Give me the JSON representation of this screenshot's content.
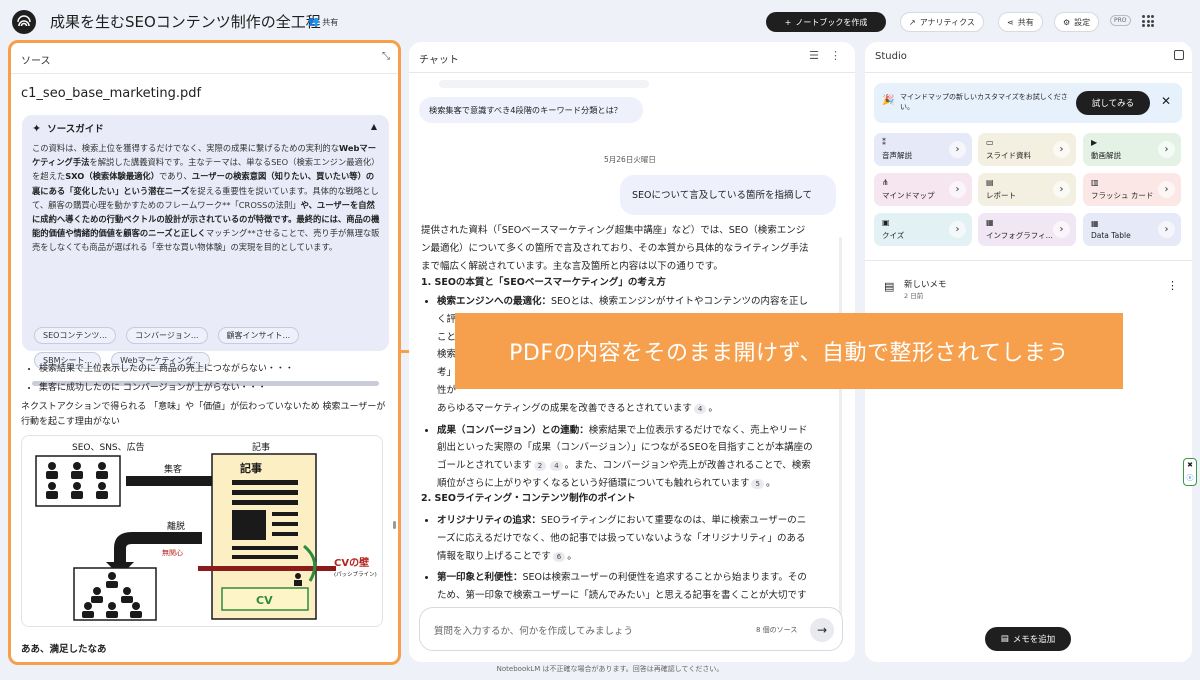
{
  "header": {
    "title": "成果を生むSEOコンテンツ制作の全工程",
    "share_chip": "共有",
    "new_notebook": "ノートブックを作成",
    "analytics": "アナリティクス",
    "share": "共有",
    "settings": "設定",
    "pro": "PRO"
  },
  "source_panel": {
    "heading": "ソース",
    "file_name": "c1_seo_base_marketing.pdf",
    "guide": {
      "title": "ソースガイド",
      "paragraph": [
        {
          "t": "この資料は、検索上位を獲得するだけでなく、実際の成果に繋げるための実利的な",
          "b": false
        },
        {
          "t": "Webマーケティング手法",
          "b": true
        },
        {
          "t": "を解説した講義資料です。主なテーマは、単なるSEO（検索エンジン最適化）を超えた",
          "b": false
        },
        {
          "t": "SXO（検索体験最適化）",
          "b": true
        },
        {
          "t": "であり、",
          "b": false
        },
        {
          "t": "ユーザーの検索意図（知りたい、買いたい等）の裏にある「変化したい」という潜在ニーズ",
          "b": true
        },
        {
          "t": "を捉える重要性を説いています。具体的な戦略として、顧客の購買心理を動かすためのフレームワーク**「CROSSの法則」",
          "b": false
        },
        {
          "t": "や、ユーザーを自然に成約へ導くための行動ベクトルの設計が示されているのが特徴です。最終的には、商品の機能的価値や情緒的価値を顧客のニーズと正しく",
          "b": true
        },
        {
          "t": "マッチング**させることで、売り手が無理な販売をしなくても商品が選ばれる「幸せな買い物体験」の実現を目的としています。",
          "b": false
        }
      ],
      "chips_row1": [
        "SEOコンテンツ...",
        "コンバージョン...",
        "顧客インサイト..."
      ],
      "chips_row2": [
        "SBMシート...",
        "Webマーケティング..."
      ]
    },
    "bullets": [
      "検索結果で上位表示したのに 商品の売上につながらない・・・",
      "集客に成功したのに コンバージョンが上がらない・・・"
    ],
    "question": "ネクストアクションで得られる 「意味」や「価値」が伝わっていないため 検索ユーザーが行動を起こす理由がない",
    "diagram": {
      "label_left": "SEO、SNS、広告",
      "label_right": "記事",
      "arrow_top": "集客",
      "arrow_bottom": "離脱",
      "sub_bottom": "無関心",
      "wall": "CVの壁",
      "wall_sub": "(パッシブライン)",
      "cv": "CV"
    },
    "closing": "ああ、満足したなあ"
  },
  "chat_panel": {
    "heading": "チャット",
    "prev_question": "検索集客で意識すべき4段階のキーワード分類とは？",
    "date": "5月26日火曜日",
    "user_message": "SEOについて言及している箇所を指摘して",
    "intro": "提供された資料（「SEOベースマーケティング超集中講座」など）では、SEO（検索エンジン最適化）について多くの箇所で言及されており、その本質から具体的なライティング手法まで幅広く解説されています。主な言及箇所と内容は以下の通りです。",
    "section1_title": "1. SEOの本質と「SEOベースマーケティング」の考え方",
    "s1_item1_head": "検索エンジンへの最適化：",
    "s1_item1_body": "SEOとは、検索エンジンがサイトやコンテンツの内容を正しく評価し、",
    "s1_item1_line2": "ことで",
    "s1_item1_cont1": "検索",
    "s1_item1_cont2": "考」",
    "s1_item1_cont3": "性が",
    "s1_item1_end": "あらゆるマーケティングの成果を改善できるとされています",
    "s1_item1_cite": "4",
    "s1_item2_head": "成果（コンバージョン）との連動：",
    "s1_item2_body": "検索結果で上位表示するだけでなく、売上やリード創出といった実際の「成果（コンバージョン）」につながるSEOを目指すことが本講座のゴールとされています",
    "s1_item2_cite_a": "2",
    "s1_item2_cite_b": "4",
    "s1_item2_body2": "。また、コンバージョンや売上が改善されることで、検索順位がさらに上がりやすくなるという好循環についても触れられています",
    "s1_item2_cite_c": "5",
    "section2_title": "2. SEOライティング・コンテンツ制作のポイント",
    "s2_item1_head": "オリジナリティの追求：",
    "s2_item1_body": "SEOライティングにおいて重要なのは、単に検索ユーザーのニーズに応えるだけでなく、他の記事では扱っていないような「オリジナリティ」のある情報を取り上げることです",
    "s2_item1_cite": "6",
    "s2_item2_head": "第一印象と利便性：",
    "s2_item2_body": "SEOは検索ユーザーの利便性を追求することから始まります。そのため、第一印象で検索ユーザーに「読んでみたい」と思える記事を書くことが大切です",
    "s2_item2_cite": "6",
    "input_placeholder": "質問を入力するか、何かを作成してみましょう",
    "source_count": "8 個のソース"
  },
  "studio_panel": {
    "heading": "Studio",
    "banner_text": "マインドマップの新しいカスタマイズをお試しください。",
    "banner_button": "試してみる",
    "cards": [
      {
        "label": "音声解説",
        "color": "#e6e9f7",
        "icon": "waveform-icon",
        "glyph": "⁑"
      },
      {
        "label": "スライド資料",
        "color": "#f3f0e2",
        "icon": "slides-icon",
        "glyph": "▭"
      },
      {
        "label": "動画解説",
        "color": "#e4f2e6",
        "icon": "video-icon",
        "glyph": "▶"
      },
      {
        "label": "マインドマップ",
        "color": "#f5e6f0",
        "icon": "mindmap-icon",
        "glyph": "⋔"
      },
      {
        "label": "レポート",
        "color": "#f3f0e2",
        "icon": "report-icon",
        "glyph": "▤"
      },
      {
        "label": "フラッシュ カード",
        "color": "#fbe8e6",
        "icon": "flashcard-icon",
        "glyph": "▥"
      },
      {
        "label": "クイズ",
        "color": "#e2f1f3",
        "icon": "quiz-icon",
        "glyph": "▣"
      },
      {
        "label": "インフォグラフィ...",
        "color": "#f0e6f4",
        "icon": "infographic-icon",
        "glyph": "▦"
      },
      {
        "label": "Data Table",
        "color": "#e6e9f7",
        "icon": "table-icon",
        "glyph": "▦"
      }
    ],
    "note_title": "新しいメモ",
    "note_time": "2 日前",
    "add_note": "メモを追加"
  },
  "overlay_text": "PDFの内容をそのまま開けず、自動で整形されてしまう",
  "footer": "NotebookLM は不正確な場合があります。回答は再確認してください。",
  "colors": {
    "accent_orange": "#f6a04d",
    "dark": "#1f1f1f",
    "guide_bg": "#e9ecf8"
  }
}
